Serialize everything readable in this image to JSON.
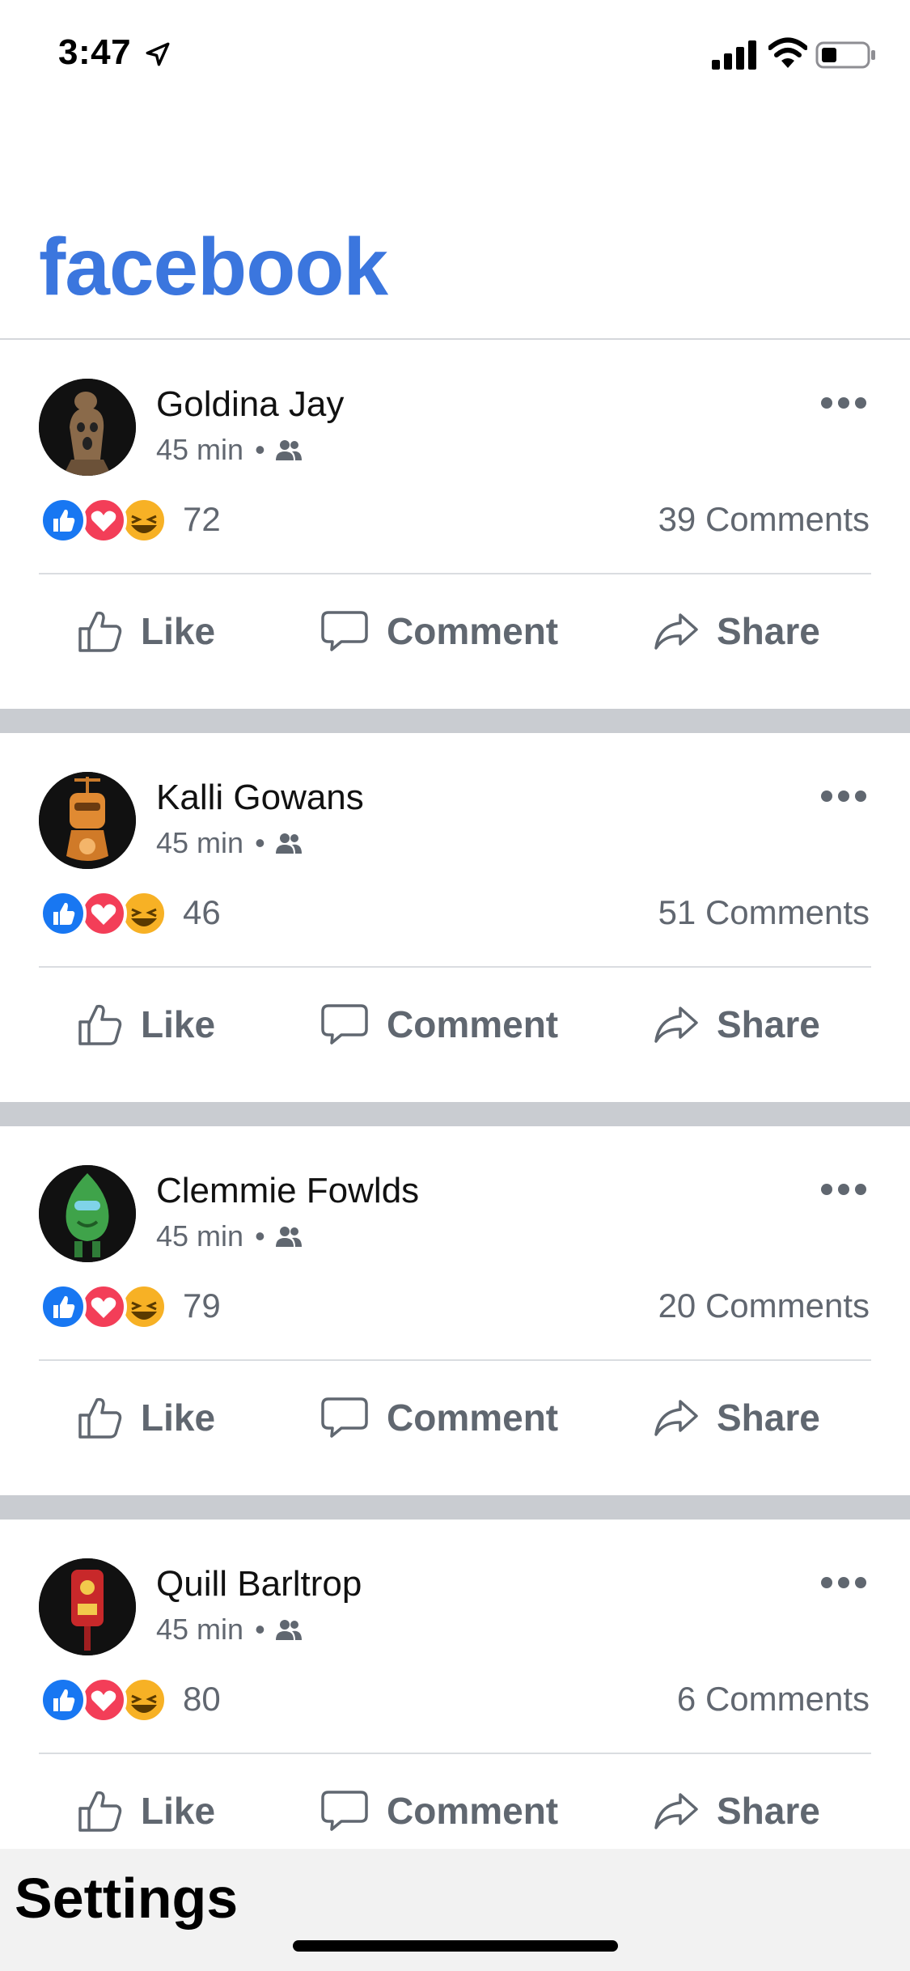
{
  "status_bar": {
    "time": "3:47"
  },
  "header": {
    "brand": "facebook"
  },
  "colors": {
    "brand": "#3b76de",
    "like": "#1877f2",
    "love": "#f33e58",
    "haha": "#f7b125",
    "separator": "#c9ccd1"
  },
  "posts": [
    {
      "author": "Goldina Jay",
      "time": "45 min",
      "dot": "•",
      "reactions": "72",
      "comments": "39 Comments",
      "avatar": "robot-avatar-brown"
    },
    {
      "author": "Kalli Gowans",
      "time": "45 min",
      "dot": "•",
      "reactions": "46",
      "comments": "51 Comments",
      "avatar": "robot-avatar-orange"
    },
    {
      "author": "Clemmie Fowlds",
      "time": "45 min",
      "dot": "•",
      "reactions": "79",
      "comments": "20 Comments",
      "avatar": "robot-avatar-green"
    },
    {
      "author": "Quill Barltrop",
      "time": "45 min",
      "dot": "•",
      "reactions": "80",
      "comments": "6 Comments",
      "avatar": "robot-avatar-red"
    }
  ],
  "actions": {
    "like": "Like",
    "comment": "Comment",
    "share": "Share"
  },
  "footer": {
    "title": "Settings"
  }
}
